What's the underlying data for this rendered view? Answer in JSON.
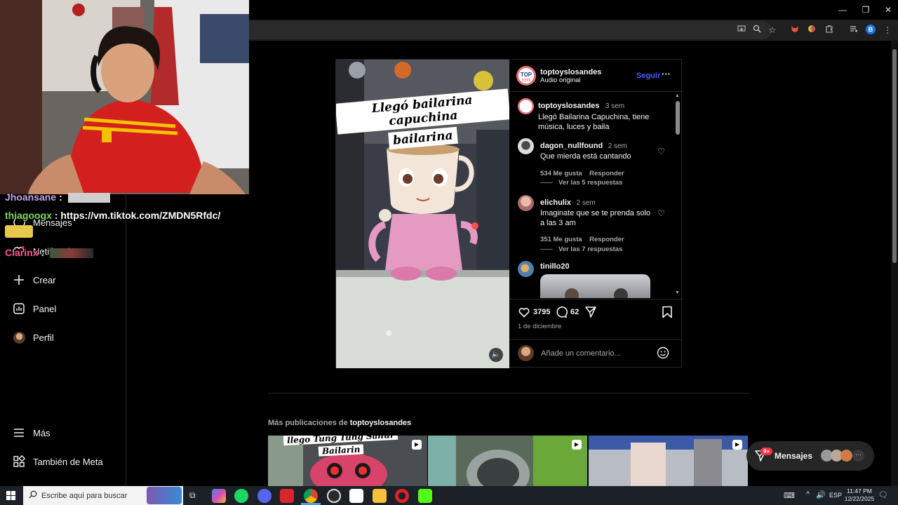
{
  "browser": {
    "window_controls": {
      "minimize": "—",
      "restore": "❐",
      "close": "✕"
    },
    "profile_initial": "B"
  },
  "sidebar": {
    "items": [
      {
        "label": "Mensajes",
        "icon": "messenger-icon"
      },
      {
        "label": "Notificaciones",
        "icon": "heart-icon"
      },
      {
        "label": "Crear",
        "icon": "plus-icon"
      },
      {
        "label": "Panel",
        "icon": "chart-icon"
      },
      {
        "label": "Perfil",
        "icon": "avatar-icon"
      }
    ],
    "bottom_items": [
      {
        "label": "Más",
        "icon": "menu-icon"
      },
      {
        "label": "También de Meta",
        "icon": "grid-icon"
      }
    ]
  },
  "stream_chat": [
    {
      "user": "Jhoansane",
      "sep": " :",
      "text": "",
      "color": "#c7a6e8"
    },
    {
      "user": "thiagoogx",
      "sep": " : ",
      "text": "https://vm.tiktok.com/ZMDN5Rfdc/",
      "color": "#7ed957"
    },
    {
      "user": "Clarinx",
      "sep": " :",
      "text": "",
      "color": "#ff5c8a"
    }
  ],
  "post": {
    "media_caption": [
      "Llegó bailarina capuchina",
      "bailarina"
    ],
    "header": {
      "username": "toptoyslosandes",
      "subtitle": "Audio original",
      "follow_label": "Seguir",
      "more_label": "···"
    },
    "caption": {
      "username": "toptoyslosandes",
      "age": "3 sem",
      "text": "Llegó Bailarina Capuchina, tiene música, luces y baila"
    },
    "comments": [
      {
        "username": "dagon_nullfound",
        "age": "2 sem",
        "text": "Que mierda está cantando",
        "likes": "534 Me gusta",
        "reply": "Responder",
        "view_replies": "Ver las 5 respuestas"
      },
      {
        "username": "elichulix",
        "age": "2 sem",
        "text": "Imaginate que se te prenda solo a las 3 am",
        "likes": "351 Me gusta",
        "reply": "Responder",
        "view_replies": "Ver las 7 respuestas"
      },
      {
        "username": "tinillo20",
        "age": "",
        "text": ""
      }
    ],
    "like_count": "3795",
    "comment_count": "62",
    "date": "1 de diciembre",
    "add_comment_placeholder": "Añade un comentario..."
  },
  "more_posts": {
    "prefix": "Más publicaciones de ",
    "username": "toptoyslosandes",
    "thumbs": [
      {
        "caption": [
          "llego Tung Tung Sahur",
          "Bailarin"
        ]
      },
      {
        "caption": []
      },
      {
        "caption": []
      }
    ]
  },
  "messages_pill": {
    "label": "Mensajes",
    "badge": "9+"
  },
  "taskbar": {
    "search_placeholder": "Escribe aquí para buscar",
    "language": "ESP",
    "time": "11:47 PM",
    "date": "12/22/2025"
  },
  "colors": {
    "accent": "#4a5df9",
    "brand_bg": "#000000"
  }
}
